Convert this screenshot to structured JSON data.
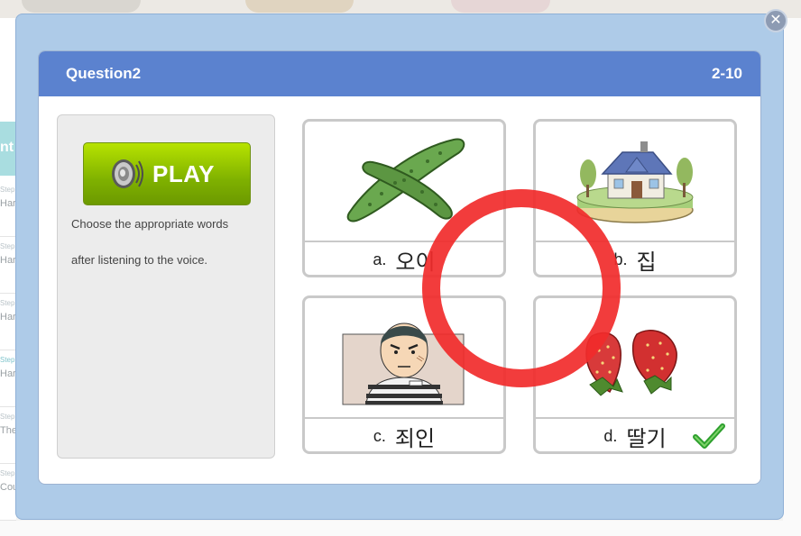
{
  "quiz": {
    "title": "Question2",
    "progress": "2-10",
    "play_label": "PLAY",
    "instruction_line1": "Choose the appropriate words",
    "instruction_line2": "after listening to the voice.",
    "options": [
      {
        "letter": "a.",
        "word": "오이",
        "image": "cucumber"
      },
      {
        "letter": "b.",
        "word": "집",
        "image": "house"
      },
      {
        "letter": "c.",
        "word": "죄인",
        "image": "prisoner"
      },
      {
        "letter": "d.",
        "word": "딸기",
        "image": "strawberry",
        "selected": true
      }
    ],
    "feedback": "correct-circle",
    "colors": {
      "header": "#5b82cf",
      "ring": "#f12b2b",
      "check": "#2ea02e"
    }
  },
  "background": {
    "sidebar_partial": [
      "Har",
      "Har",
      "Har",
      "Har",
      "The",
      "Cou"
    ],
    "tab_partial": "nt"
  }
}
